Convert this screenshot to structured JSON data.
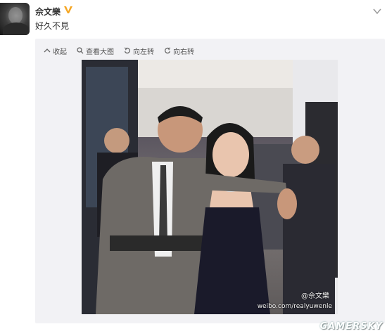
{
  "post": {
    "author": "佘文樂",
    "text": "好久不見"
  },
  "toolbar": {
    "collapse": "收起",
    "view_large": "查看大图",
    "rotate_left": "向左转",
    "rotate_right": "向右转"
  },
  "photo": {
    "watermark_name": "@佘文樂",
    "watermark_url": "weibo.com/realyuwenle"
  },
  "site_watermark": "GAMERSKY",
  "colors": {
    "verified": "#f5a623",
    "media_bg": "#f2f2f5",
    "text": "#333333"
  },
  "icons": [
    "verified-v-icon",
    "dropdown-icon",
    "collapse-icon",
    "search-icon",
    "rotate-left-icon",
    "rotate-right-icon"
  ]
}
